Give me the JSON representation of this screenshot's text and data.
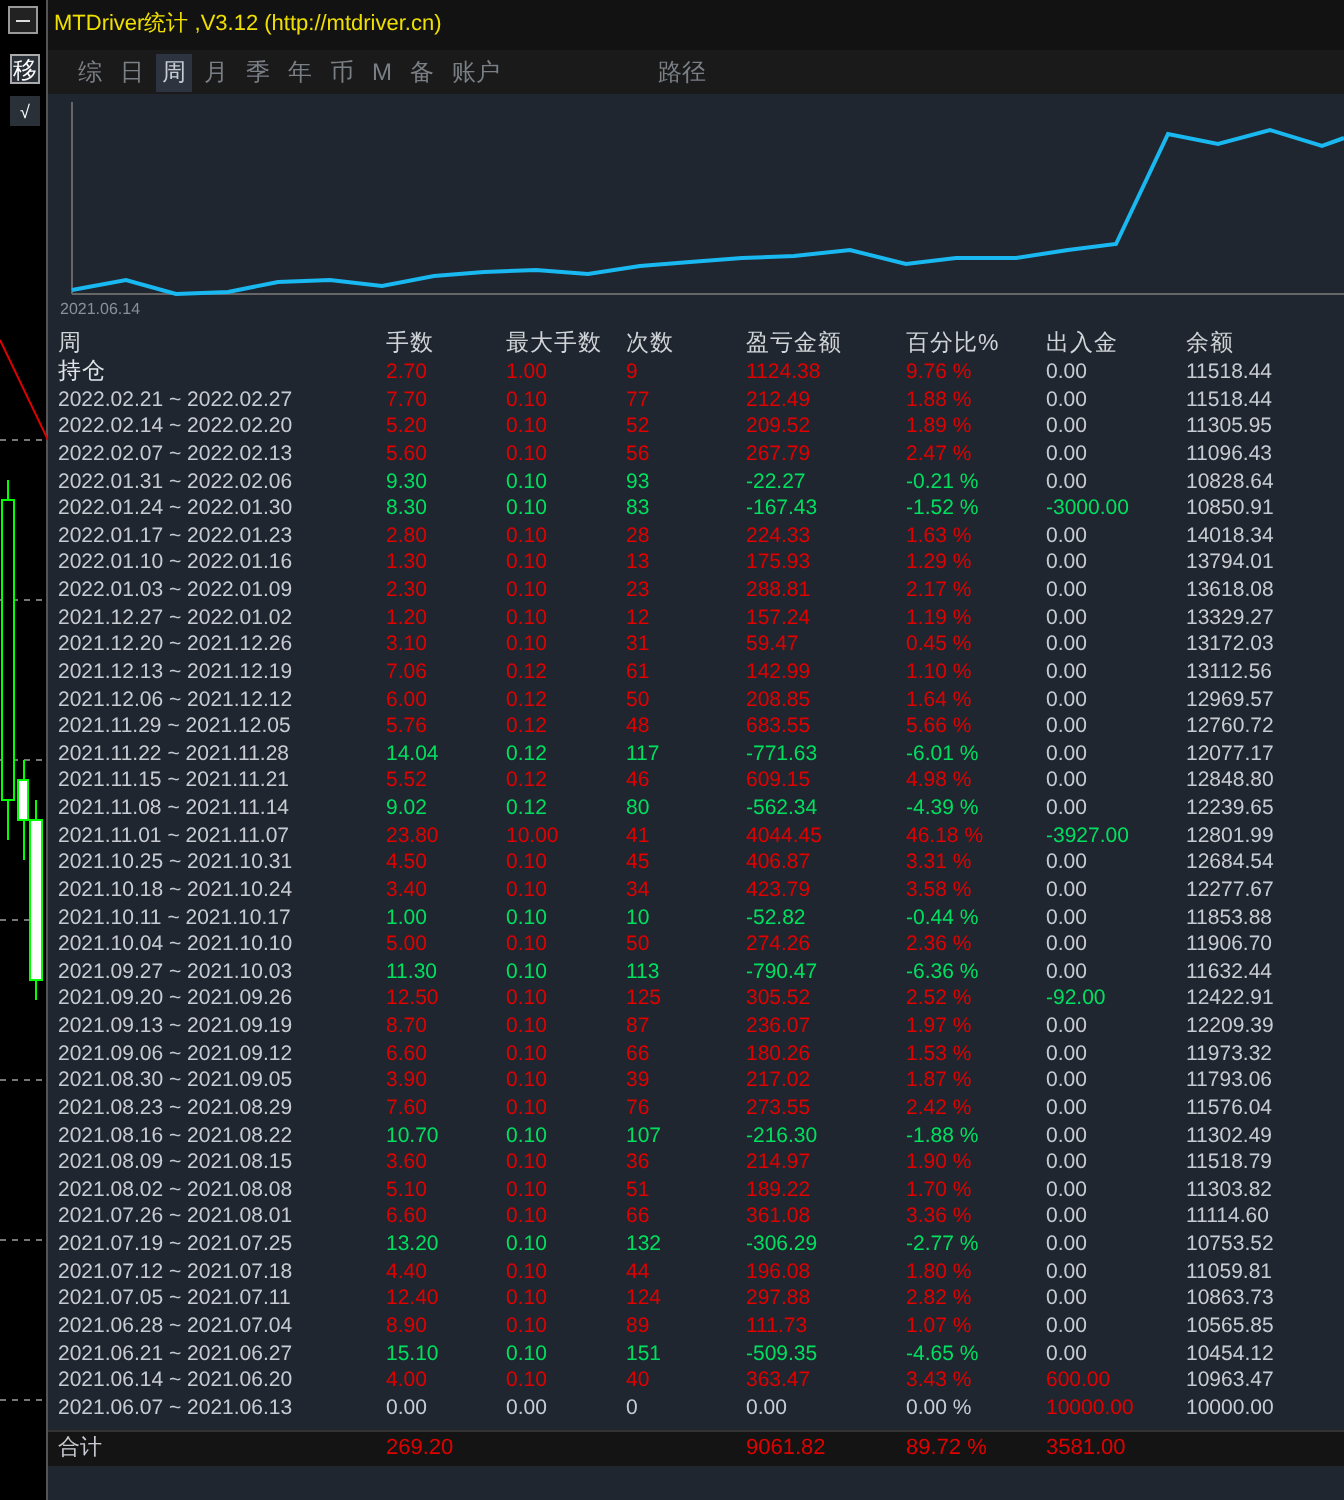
{
  "window": {
    "title": "MTDriver统计 ,V3.12 (http://mtdriver.cn)"
  },
  "side_buttons": [
    "移",
    "√"
  ],
  "tabs": [
    {
      "label": "综",
      "selected": false
    },
    {
      "label": "日",
      "selected": false
    },
    {
      "label": "周",
      "selected": true
    },
    {
      "label": "月",
      "selected": false
    },
    {
      "label": "季",
      "selected": false
    },
    {
      "label": "年",
      "selected": false
    },
    {
      "label": "币",
      "selected": false
    },
    {
      "label": "M",
      "selected": false
    },
    {
      "label": "备",
      "selected": false
    },
    {
      "label": "账户",
      "selected": false
    },
    {
      "label": "路径",
      "selected": false
    }
  ],
  "chart": {
    "start_label": "2021.06.14"
  },
  "table": {
    "columns": [
      "周",
      "手数",
      "最大手数",
      "次数",
      "盈亏金额",
      "百分比%",
      "出入金",
      "余额"
    ],
    "rows": [
      {
        "week": "持仓",
        "lots": "2.70",
        "max_lots": "1.00",
        "trades": "9",
        "profit": "1124.38",
        "percent": "9.76 %",
        "deposit": {
          "value": "0.00",
          "color": "#c8ccd2"
        },
        "balance": "11518.44",
        "color": "#e00000"
      },
      {
        "week": "2022.02.21 ~ 2022.02.27",
        "lots": "7.70",
        "max_lots": "0.10",
        "trades": "77",
        "profit": "212.49",
        "percent": "1.88 %",
        "deposit": {
          "value": "0.00",
          "color": "#c8ccd2"
        },
        "balance": "11518.44",
        "color": "#e00000"
      },
      {
        "week": "2022.02.14 ~ 2022.02.20",
        "lots": "5.20",
        "max_lots": "0.10",
        "trades": "52",
        "profit": "209.52",
        "percent": "1.89 %",
        "deposit": {
          "value": "0.00",
          "color": "#c8ccd2"
        },
        "balance": "11305.95",
        "color": "#e00000"
      },
      {
        "week": "2022.02.07 ~ 2022.02.13",
        "lots": "5.60",
        "max_lots": "0.10",
        "trades": "56",
        "profit": "267.79",
        "percent": "2.47 %",
        "deposit": {
          "value": "0.00",
          "color": "#c8ccd2"
        },
        "balance": "11096.43",
        "color": "#e00000"
      },
      {
        "week": "2022.01.31 ~ 2022.02.06",
        "lots": "9.30",
        "max_lots": "0.10",
        "trades": "93",
        "profit": "-22.27",
        "percent": "-0.21 %",
        "deposit": {
          "value": "0.00",
          "color": "#c8ccd2"
        },
        "balance": "10828.64",
        "color": "#00e060"
      },
      {
        "week": "2022.01.24 ~ 2022.01.30",
        "lots": "8.30",
        "max_lots": "0.10",
        "trades": "83",
        "profit": "-167.43",
        "percent": "-1.52 %",
        "deposit": {
          "value": "-3000.00",
          "color": "#00e060"
        },
        "balance": "10850.91",
        "color": "#00e060"
      },
      {
        "week": "2022.01.17 ~ 2022.01.23",
        "lots": "2.80",
        "max_lots": "0.10",
        "trades": "28",
        "profit": "224.33",
        "percent": "1.63 %",
        "deposit": {
          "value": "0.00",
          "color": "#c8ccd2"
        },
        "balance": "14018.34",
        "color": "#e00000"
      },
      {
        "week": "2022.01.10 ~ 2022.01.16",
        "lots": "1.30",
        "max_lots": "0.10",
        "trades": "13",
        "profit": "175.93",
        "percent": "1.29 %",
        "deposit": {
          "value": "0.00",
          "color": "#c8ccd2"
        },
        "balance": "13794.01",
        "color": "#e00000"
      },
      {
        "week": "2022.01.03 ~ 2022.01.09",
        "lots": "2.30",
        "max_lots": "0.10",
        "trades": "23",
        "profit": "288.81",
        "percent": "2.17 %",
        "deposit": {
          "value": "0.00",
          "color": "#c8ccd2"
        },
        "balance": "13618.08",
        "color": "#e00000"
      },
      {
        "week": "2021.12.27 ~ 2022.01.02",
        "lots": "1.20",
        "max_lots": "0.10",
        "trades": "12",
        "profit": "157.24",
        "percent": "1.19 %",
        "deposit": {
          "value": "0.00",
          "color": "#c8ccd2"
        },
        "balance": "13329.27",
        "color": "#e00000"
      },
      {
        "week": "2021.12.20 ~ 2021.12.26",
        "lots": "3.10",
        "max_lots": "0.10",
        "trades": "31",
        "profit": "59.47",
        "percent": "0.45 %",
        "deposit": {
          "value": "0.00",
          "color": "#c8ccd2"
        },
        "balance": "13172.03",
        "color": "#e00000"
      },
      {
        "week": "2021.12.13 ~ 2021.12.19",
        "lots": "7.06",
        "max_lots": "0.12",
        "trades": "61",
        "profit": "142.99",
        "percent": "1.10 %",
        "deposit": {
          "value": "0.00",
          "color": "#c8ccd2"
        },
        "balance": "13112.56",
        "color": "#e00000"
      },
      {
        "week": "2021.12.06 ~ 2021.12.12",
        "lots": "6.00",
        "max_lots": "0.12",
        "trades": "50",
        "profit": "208.85",
        "percent": "1.64 %",
        "deposit": {
          "value": "0.00",
          "color": "#c8ccd2"
        },
        "balance": "12969.57",
        "color": "#e00000"
      },
      {
        "week": "2021.11.29 ~ 2021.12.05",
        "lots": "5.76",
        "max_lots": "0.12",
        "trades": "48",
        "profit": "683.55",
        "percent": "5.66 %",
        "deposit": {
          "value": "0.00",
          "color": "#c8ccd2"
        },
        "balance": "12760.72",
        "color": "#e00000"
      },
      {
        "week": "2021.11.22 ~ 2021.11.28",
        "lots": "14.04",
        "max_lots": "0.12",
        "trades": "117",
        "profit": "-771.63",
        "percent": "-6.01 %",
        "deposit": {
          "value": "0.00",
          "color": "#c8ccd2"
        },
        "balance": "12077.17",
        "color": "#00e060"
      },
      {
        "week": "2021.11.15 ~ 2021.11.21",
        "lots": "5.52",
        "max_lots": "0.12",
        "trades": "46",
        "profit": "609.15",
        "percent": "4.98 %",
        "deposit": {
          "value": "0.00",
          "color": "#c8ccd2"
        },
        "balance": "12848.80",
        "color": "#e00000"
      },
      {
        "week": "2021.11.08 ~ 2021.11.14",
        "lots": "9.02",
        "max_lots": "0.12",
        "trades": "80",
        "profit": "-562.34",
        "percent": "-4.39 %",
        "deposit": {
          "value": "0.00",
          "color": "#c8ccd2"
        },
        "balance": "12239.65",
        "color": "#00e060"
      },
      {
        "week": "2021.11.01 ~ 2021.11.07",
        "lots": "23.80",
        "max_lots": "10.00",
        "trades": "41",
        "profit": "4044.45",
        "percent": "46.18 %",
        "deposit": {
          "value": "-3927.00",
          "color": "#00e060"
        },
        "balance": "12801.99",
        "color": "#e00000"
      },
      {
        "week": "2021.10.25 ~ 2021.10.31",
        "lots": "4.50",
        "max_lots": "0.10",
        "trades": "45",
        "profit": "406.87",
        "percent": "3.31 %",
        "deposit": {
          "value": "0.00",
          "color": "#c8ccd2"
        },
        "balance": "12684.54",
        "color": "#e00000"
      },
      {
        "week": "2021.10.18 ~ 2021.10.24",
        "lots": "3.40",
        "max_lots": "0.10",
        "trades": "34",
        "profit": "423.79",
        "percent": "3.58 %",
        "deposit": {
          "value": "0.00",
          "color": "#c8ccd2"
        },
        "balance": "12277.67",
        "color": "#e00000"
      },
      {
        "week": "2021.10.11 ~ 2021.10.17",
        "lots": "1.00",
        "max_lots": "0.10",
        "trades": "10",
        "profit": "-52.82",
        "percent": "-0.44 %",
        "deposit": {
          "value": "0.00",
          "color": "#c8ccd2"
        },
        "balance": "11853.88",
        "color": "#00e060"
      },
      {
        "week": "2021.10.04 ~ 2021.10.10",
        "lots": "5.00",
        "max_lots": "0.10",
        "trades": "50",
        "profit": "274.26",
        "percent": "2.36 %",
        "deposit": {
          "value": "0.00",
          "color": "#c8ccd2"
        },
        "balance": "11906.70",
        "color": "#e00000"
      },
      {
        "week": "2021.09.27 ~ 2021.10.03",
        "lots": "11.30",
        "max_lots": "0.10",
        "trades": "113",
        "profit": "-790.47",
        "percent": "-6.36 %",
        "deposit": {
          "value": "0.00",
          "color": "#c8ccd2"
        },
        "balance": "11632.44",
        "color": "#00e060"
      },
      {
        "week": "2021.09.20 ~ 2021.09.26",
        "lots": "12.50",
        "max_lots": "0.10",
        "trades": "125",
        "profit": "305.52",
        "percent": "2.52 %",
        "deposit": {
          "value": "-92.00",
          "color": "#00e060"
        },
        "balance": "12422.91",
        "color": "#e00000"
      },
      {
        "week": "2021.09.13 ~ 2021.09.19",
        "lots": "8.70",
        "max_lots": "0.10",
        "trades": "87",
        "profit": "236.07",
        "percent": "1.97 %",
        "deposit": {
          "value": "0.00",
          "color": "#c8ccd2"
        },
        "balance": "12209.39",
        "color": "#e00000"
      },
      {
        "week": "2021.09.06 ~ 2021.09.12",
        "lots": "6.60",
        "max_lots": "0.10",
        "trades": "66",
        "profit": "180.26",
        "percent": "1.53 %",
        "deposit": {
          "value": "0.00",
          "color": "#c8ccd2"
        },
        "balance": "11973.32",
        "color": "#e00000"
      },
      {
        "week": "2021.08.30 ~ 2021.09.05",
        "lots": "3.90",
        "max_lots": "0.10",
        "trades": "39",
        "profit": "217.02",
        "percent": "1.87 %",
        "deposit": {
          "value": "0.00",
          "color": "#c8ccd2"
        },
        "balance": "11793.06",
        "color": "#e00000"
      },
      {
        "week": "2021.08.23 ~ 2021.08.29",
        "lots": "7.60",
        "max_lots": "0.10",
        "trades": "76",
        "profit": "273.55",
        "percent": "2.42 %",
        "deposit": {
          "value": "0.00",
          "color": "#c8ccd2"
        },
        "balance": "11576.04",
        "color": "#e00000"
      },
      {
        "week": "2021.08.16 ~ 2021.08.22",
        "lots": "10.70",
        "max_lots": "0.10",
        "trades": "107",
        "profit": "-216.30",
        "percent": "-1.88 %",
        "deposit": {
          "value": "0.00",
          "color": "#c8ccd2"
        },
        "balance": "11302.49",
        "color": "#00e060"
      },
      {
        "week": "2021.08.09 ~ 2021.08.15",
        "lots": "3.60",
        "max_lots": "0.10",
        "trades": "36",
        "profit": "214.97",
        "percent": "1.90 %",
        "deposit": {
          "value": "0.00",
          "color": "#c8ccd2"
        },
        "balance": "11518.79",
        "color": "#e00000"
      },
      {
        "week": "2021.08.02 ~ 2021.08.08",
        "lots": "5.10",
        "max_lots": "0.10",
        "trades": "51",
        "profit": "189.22",
        "percent": "1.70 %",
        "deposit": {
          "value": "0.00",
          "color": "#c8ccd2"
        },
        "balance": "11303.82",
        "color": "#e00000"
      },
      {
        "week": "2021.07.26 ~ 2021.08.01",
        "lots": "6.60",
        "max_lots": "0.10",
        "trades": "66",
        "profit": "361.08",
        "percent": "3.36 %",
        "deposit": {
          "value": "0.00",
          "color": "#c8ccd2"
        },
        "balance": "11114.60",
        "color": "#e00000"
      },
      {
        "week": "2021.07.19 ~ 2021.07.25",
        "lots": "13.20",
        "max_lots": "0.10",
        "trades": "132",
        "profit": "-306.29",
        "percent": "-2.77 %",
        "deposit": {
          "value": "0.00",
          "color": "#c8ccd2"
        },
        "balance": "10753.52",
        "color": "#00e060"
      },
      {
        "week": "2021.07.12 ~ 2021.07.18",
        "lots": "4.40",
        "max_lots": "0.10",
        "trades": "44",
        "profit": "196.08",
        "percent": "1.80 %",
        "deposit": {
          "value": "0.00",
          "color": "#c8ccd2"
        },
        "balance": "11059.81",
        "color": "#e00000"
      },
      {
        "week": "2021.07.05 ~ 2021.07.11",
        "lots": "12.40",
        "max_lots": "0.10",
        "trades": "124",
        "profit": "297.88",
        "percent": "2.82 %",
        "deposit": {
          "value": "0.00",
          "color": "#c8ccd2"
        },
        "balance": "10863.73",
        "color": "#e00000"
      },
      {
        "week": "2021.06.28 ~ 2021.07.04",
        "lots": "8.90",
        "max_lots": "0.10",
        "trades": "89",
        "profit": "111.73",
        "percent": "1.07 %",
        "deposit": {
          "value": "0.00",
          "color": "#c8ccd2"
        },
        "balance": "10565.85",
        "color": "#e00000"
      },
      {
        "week": "2021.06.21 ~ 2021.06.27",
        "lots": "15.10",
        "max_lots": "0.10",
        "trades": "151",
        "profit": "-509.35",
        "percent": "-4.65 %",
        "deposit": {
          "value": "0.00",
          "color": "#c8ccd2"
        },
        "balance": "10454.12",
        "color": "#00e060"
      },
      {
        "week": "2021.06.14 ~ 2021.06.20",
        "lots": "4.00",
        "max_lots": "0.10",
        "trades": "40",
        "profit": "363.47",
        "percent": "3.43 %",
        "deposit": {
          "value": "600.00",
          "color": "#e00000"
        },
        "balance": "10963.47",
        "color": "#e00000"
      },
      {
        "week": "2021.06.07 ~ 2021.06.13",
        "lots": "0.00",
        "max_lots": "0.00",
        "trades": "0",
        "profit": "0.00",
        "percent": "0.00 %",
        "deposit": {
          "value": "10000.00",
          "color": "#e00000"
        },
        "balance": "10000.00",
        "color": "#c8ccd2"
      }
    ],
    "total": {
      "label": "合计",
      "lots": "269.20",
      "profit": "9061.82",
      "percent": "89.72 %",
      "deposit": {
        "value": "3581.00",
        "color": "#e00000"
      },
      "color": "#e00000"
    }
  }
}
